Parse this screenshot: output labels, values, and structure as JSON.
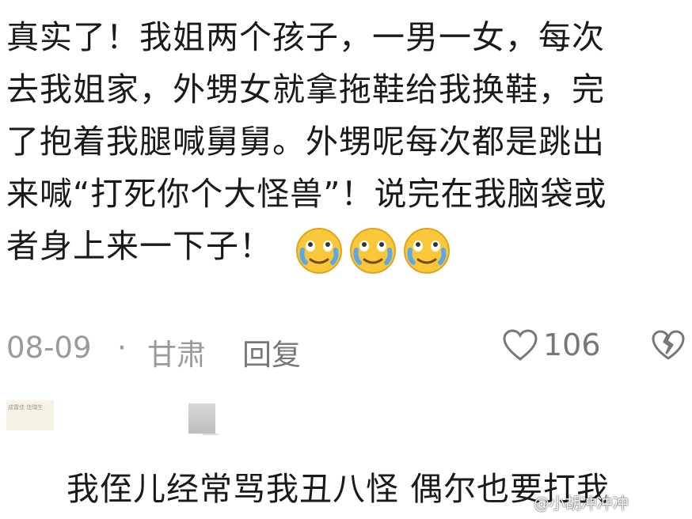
{
  "comment": {
    "lines": [
      "真实了！我姐两个孩子，一男一女，每次",
      "去我姐家，外甥女就拿拖鞋给我换鞋，完",
      "了抱着我腿喊舅舅。外甥呢每次都是跳出",
      "来喊“打死你个大怪兽”！说完在我脑袋或",
      "者身上来一下子！"
    ],
    "emoji_icon": "crying-laughing-face",
    "emoji_count": 3,
    "date": "08-09",
    "separator": "·",
    "location": "甘肃",
    "reply_label": "回复",
    "like_count": "106"
  },
  "next_comment": {
    "avatar_text": "成雷佳 佳瑞生",
    "text": "我侄儿经常骂我丑八怪 偶尔也要打我"
  },
  "watermark": "@小胡冲冲冲",
  "colors": {
    "text": "#1a1a1a",
    "meta": "#9a9a9a",
    "icon": "#777777"
  }
}
